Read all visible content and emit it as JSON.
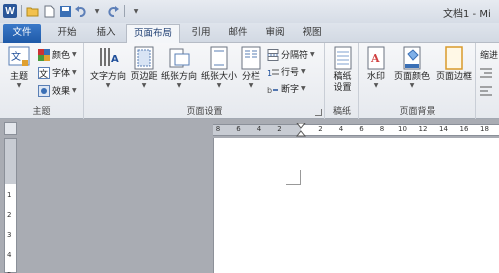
{
  "window": {
    "title": "文档1 - Mi"
  },
  "tabs": {
    "file": "文件",
    "home": "开始",
    "insert": "插入",
    "page_layout": "页面布局",
    "references": "引用",
    "mailings": "邮件",
    "review": "审阅",
    "view": "视图"
  },
  "ribbon": {
    "themes": {
      "label": "主题",
      "themes_btn": "主题",
      "colors": "颜色",
      "fonts": "字体",
      "effects": "效果"
    },
    "page_setup": {
      "label": "页面设置",
      "text_direction": "文字方向",
      "margins": "页边距",
      "orientation": "纸张方向",
      "size": "纸张大小",
      "columns": "分栏",
      "breaks": "分隔符",
      "line_numbers": "行号",
      "hyphenation": "断字"
    },
    "draft_paper": {
      "label": "稿纸",
      "draft_settings": "稿纸\n设置"
    },
    "page_background": {
      "label": "页面背景",
      "watermark": "水印",
      "page_color": "页面颜色",
      "page_borders": "页面边框"
    },
    "paragraph": {
      "indent": "缩进"
    }
  },
  "ruler": {
    "h_ticks": [
      "8",
      "6",
      "4",
      "2",
      "",
      "2",
      "4",
      "6",
      "8",
      "10",
      "12",
      "14",
      "16",
      "18"
    ],
    "v_ticks": [
      "1",
      "2",
      "3",
      "4",
      "5"
    ]
  }
}
